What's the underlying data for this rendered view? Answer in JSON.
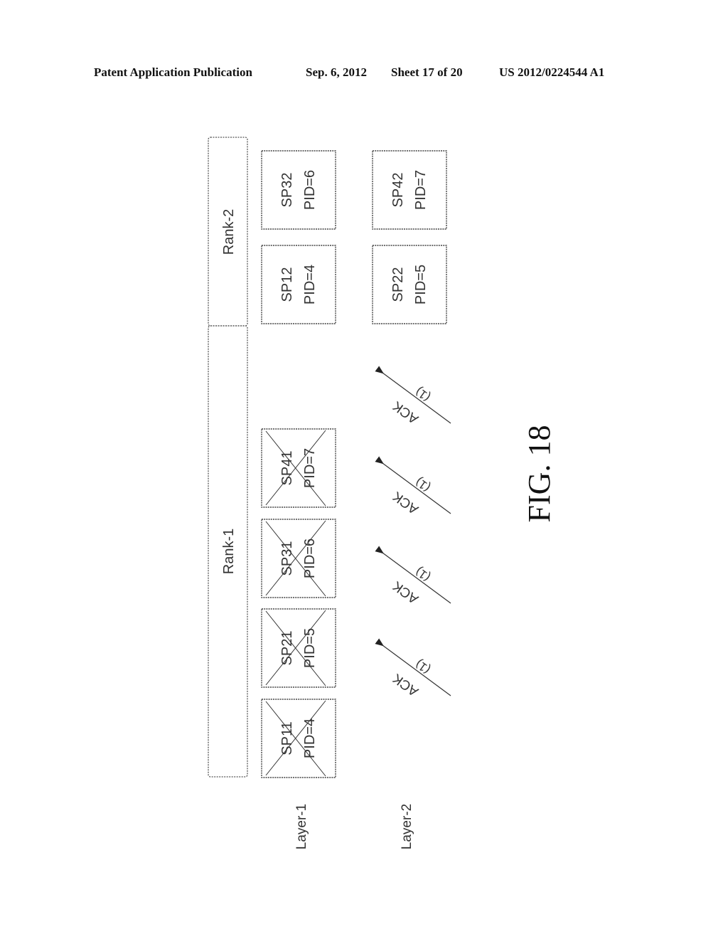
{
  "header": {
    "publication": "Patent Application Publication",
    "date": "Sep. 6, 2012",
    "sheet": "Sheet 17 of 20",
    "number": "US 2012/0224544 A1"
  },
  "figure": {
    "label": "FIG. 18",
    "ranks": [
      {
        "label": "Rank-1"
      },
      {
        "label": "Rank-2"
      }
    ],
    "layers": [
      {
        "label": "Layer-1"
      },
      {
        "label": "Layer-2"
      }
    ],
    "layer1_boxes": [
      {
        "name": "SP11",
        "pid": "PID=4",
        "crossed": true
      },
      {
        "name": "SP21",
        "pid": "PID=5",
        "crossed": true
      },
      {
        "name": "SP31",
        "pid": "PID=6",
        "crossed": true
      },
      {
        "name": "SP41",
        "pid": "PID=7",
        "crossed": true
      },
      {
        "name": "SP12",
        "pid": "PID=4",
        "crossed": false
      },
      {
        "name": "SP32",
        "pid": "PID=6",
        "crossed": false
      }
    ],
    "layer2_boxes": [
      {
        "name": "SP22",
        "pid": "PID=5",
        "crossed": false
      },
      {
        "name": "SP42",
        "pid": "PID=7",
        "crossed": false
      }
    ],
    "acks": [
      {
        "label": "ACK",
        "sub": "(1)"
      },
      {
        "label": "ACK",
        "sub": "(1)"
      },
      {
        "label": "ACK",
        "sub": "(1)"
      },
      {
        "label": "ACK",
        "sub": "(1)"
      }
    ]
  }
}
